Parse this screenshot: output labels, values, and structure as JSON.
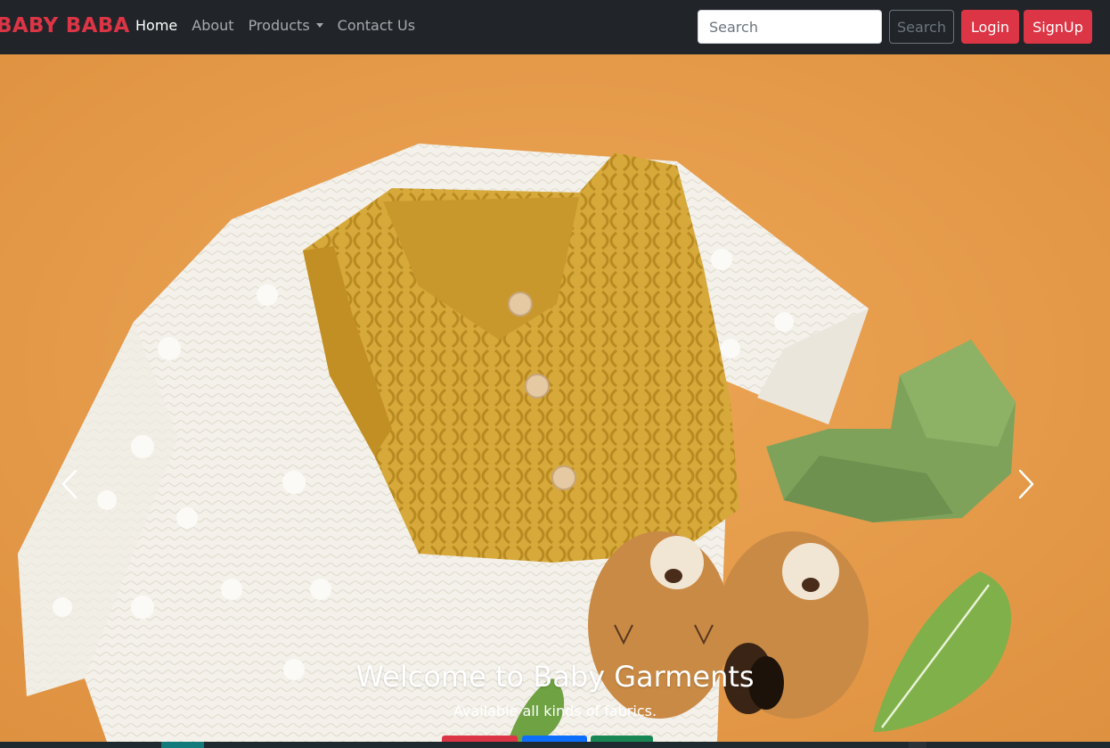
{
  "nav": {
    "brand": "BABY BABA",
    "links": [
      {
        "label": "Home",
        "active": true
      },
      {
        "label": "About",
        "active": false
      },
      {
        "label": "Products",
        "active": false,
        "dropdown": true
      },
      {
        "label": "Contact Us",
        "active": false
      }
    ],
    "search_placeholder": "Search",
    "search_button": "Search",
    "login_button": "Login",
    "signup_button": "SignUp"
  },
  "carousel": {
    "caption_title": "Welcome to Baby Garments",
    "caption_text": "Available all kinds of fabrics.",
    "prev_icon": "chevron-left-icon",
    "next_icon": "chevron-right-icon",
    "indicator_colors": [
      "#dc3545",
      "#0d6efd",
      "#198754"
    ]
  },
  "colors": {
    "navbar_bg": "#212529",
    "brand": "#dc3545",
    "accent_red": "#dc3545",
    "hero_bg": "#e59b4a"
  }
}
